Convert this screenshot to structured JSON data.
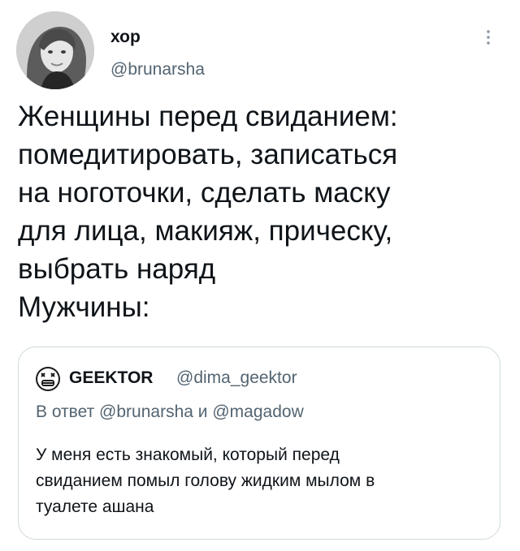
{
  "tweet": {
    "author": {
      "name": "хор",
      "handle": "@brunarsha",
      "avatar_icon": "person-photo-avatar"
    },
    "more_icon": "more-vertical-icon",
    "text_lines": [
      "Женщины перед свиданием:",
      "помедитировать, записаться",
      "на ноготочки, сделать маску",
      "для лица, макияж, прическу,",
      "выбрать наряд",
      "Мужчины:"
    ]
  },
  "quote": {
    "author": {
      "name": "GEEKTOR",
      "handle": "@dima_geektor",
      "avatar_icon": "emoji-face-avatar"
    },
    "reply": {
      "prefix": "В ответ",
      "mention_1": "@brunarsha",
      "conjunction": "и",
      "mention_2": "@magadow"
    },
    "text_lines": [
      "У меня есть знакомый, который перед",
      "свиданием помыл голову жидким мылом в",
      "туалете ашана"
    ]
  },
  "colors": {
    "text_primary": "#0f1419",
    "text_secondary": "#536471",
    "border": "#cfd9de",
    "background": "#ffffff"
  }
}
